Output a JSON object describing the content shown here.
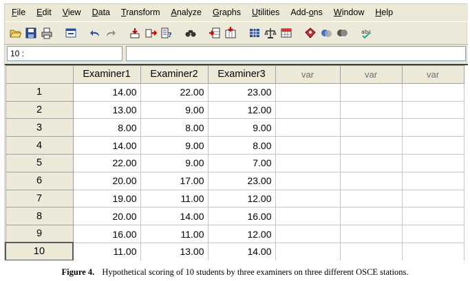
{
  "menu": [
    {
      "pre": "",
      "ul": "F",
      "post": "ile"
    },
    {
      "pre": "",
      "ul": "E",
      "post": "dit"
    },
    {
      "pre": "",
      "ul": "V",
      "post": "iew"
    },
    {
      "pre": "",
      "ul": "D",
      "post": "ata"
    },
    {
      "pre": "",
      "ul": "T",
      "post": "ransform"
    },
    {
      "pre": "",
      "ul": "A",
      "post": "nalyze"
    },
    {
      "pre": "",
      "ul": "G",
      "post": "raphs"
    },
    {
      "pre": "",
      "ul": "U",
      "post": "tilities"
    },
    {
      "pre": "Add-",
      "ul": "o",
      "post": "ns"
    },
    {
      "pre": "",
      "ul": "W",
      "post": "indow"
    },
    {
      "pre": "",
      "ul": "H",
      "post": "elp"
    }
  ],
  "toolbar_icons": [
    [
      "open-folder-icon",
      "save-disk-icon",
      "print-icon"
    ],
    [
      "dialog-recall-icon"
    ],
    [
      "undo-icon",
      "redo-icon"
    ],
    [
      "goto-case-icon",
      "goto-variable-icon",
      "variables-info-icon"
    ],
    [
      "find-icon"
    ],
    [
      "insert-cases-icon",
      "insert-variable-icon"
    ],
    [
      "split-file-icon",
      "weight-cases-icon",
      "select-cases-icon"
    ],
    [
      "value-labels-icon",
      "use-sets-icon",
      "show-all-variables-icon"
    ],
    [
      "spell-check-icon"
    ]
  ],
  "cell_editor": {
    "ref": "10 :",
    "value": ""
  },
  "grid": {
    "columns": [
      "Examiner1",
      "Examiner2",
      "Examiner3",
      "var",
      "var",
      "var"
    ],
    "rows": [
      {
        "n": "1",
        "v": [
          "14.00",
          "22.00",
          "23.00"
        ]
      },
      {
        "n": "2",
        "v": [
          "13.00",
          "9.00",
          "12.00"
        ]
      },
      {
        "n": "3",
        "v": [
          "8.00",
          "8.00",
          "9.00"
        ]
      },
      {
        "n": "4",
        "v": [
          "14.00",
          "9.00",
          "8.00"
        ]
      },
      {
        "n": "5",
        "v": [
          "22.00",
          "9.00",
          "7.00"
        ]
      },
      {
        "n": "6",
        "v": [
          "20.00",
          "17.00",
          "23.00"
        ]
      },
      {
        "n": "7",
        "v": [
          "19.00",
          "11.00",
          "12.00"
        ]
      },
      {
        "n": "8",
        "v": [
          "20.00",
          "14.00",
          "16.00"
        ]
      },
      {
        "n": "9",
        "v": [
          "16.00",
          "11.00",
          "12.00"
        ]
      },
      {
        "n": "10",
        "v": [
          "11.00",
          "13.00",
          "14.00"
        ]
      }
    ]
  },
  "caption": {
    "label": "Figure 4.",
    "text": "Hypothetical scoring of 10 students by three examiners on three different OSCE stations."
  }
}
